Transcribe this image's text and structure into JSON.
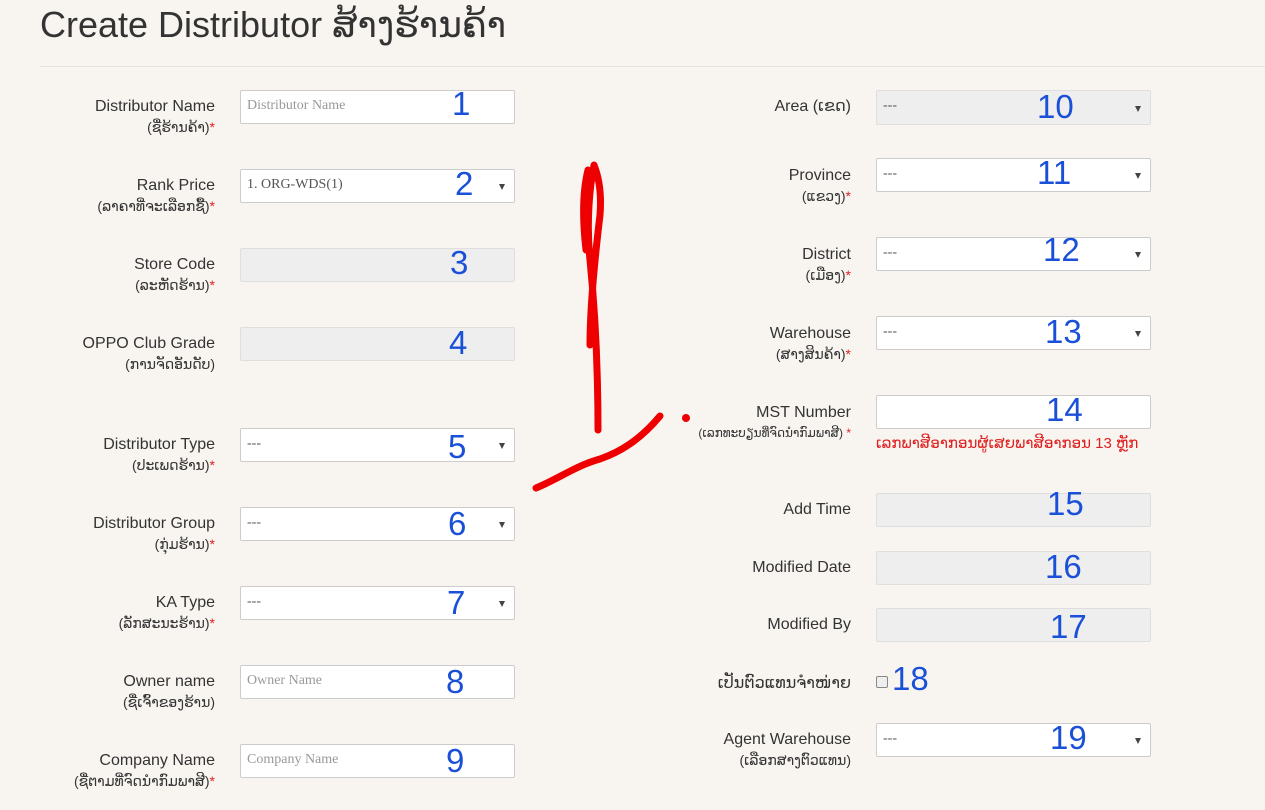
{
  "page": {
    "title": "Create Distributor ສ້າງຮ້ານຄ້າ"
  },
  "left_fields": [
    {
      "label": "Distributor Name",
      "sublabel": "(ຊື່ຮ້ານຄ້າ)",
      "required": "*",
      "placeholder": "Distributor Name",
      "value": "",
      "number": "1"
    },
    {
      "label": "Rank Price",
      "sublabel": "(ລາຄາທີ່ຈະເລືອກຊື້)",
      "required": "*",
      "value": "1. ORG-WDS(1)",
      "number": "2"
    },
    {
      "label": "Store Code",
      "sublabel": "(ລະຫັດຮ້ານ)",
      "required": "*",
      "value": "",
      "number": "3"
    },
    {
      "label": "OPPO Club Grade",
      "sublabel": "(ການຈັດອັນດັບ)",
      "required": "",
      "value": "",
      "number": "4"
    },
    {
      "label": "Distributor Type",
      "sublabel": "(ປະເພດຮ້ານ)",
      "required": "*",
      "value": "---",
      "number": "5"
    },
    {
      "label": "Distributor Group",
      "sublabel": "(ກຸ່ມຮ້ານ)",
      "required": "*",
      "value": "---",
      "number": "6"
    },
    {
      "label": "KA Type",
      "sublabel": "(ລັກສະນະຮ້ານ)",
      "required": "*",
      "value": "---",
      "number": "7"
    },
    {
      "label": "Owner name",
      "sublabel": "(ຊື່ເຈົ້າຂອງຮ້ານ)",
      "required": "",
      "placeholder": "Owner Name",
      "value": "",
      "number": "8"
    },
    {
      "label": "Company Name",
      "sublabel": "(ຊື່ຕາມທີ່ຈົດນຳກົມພາສີ)",
      "required": "*",
      "placeholder": "Company Name",
      "value": "",
      "number": "9"
    }
  ],
  "right_fields": [
    {
      "label": "Area (ເຂດ)",
      "sublabel": "",
      "required": "",
      "value": "---",
      "number": "10"
    },
    {
      "label": "Province",
      "sublabel": "(ແຂວງ)",
      "required": "*",
      "value": "---",
      "number": "11"
    },
    {
      "label": "District",
      "sublabel": "(ເມືອງ)",
      "required": "*",
      "value": "---",
      "number": "12"
    },
    {
      "label": "Warehouse",
      "sublabel": "(ສາງສິນຄ້າ)",
      "required": "*",
      "value": "---",
      "number": "13"
    },
    {
      "label": "MST Number",
      "sublabel": "(ເລກທະບຽນທີ່ຈົດນຳກົມພາສີ)",
      "required": "*",
      "value": "",
      "number": "14",
      "hint": "ເລກພາສີອາກອນຜູ້ເສຍພາສີອາກອນ 13 ຫຼັກ"
    },
    {
      "label": "Add Time",
      "sublabel": "",
      "required": "",
      "value": "",
      "number": "15"
    },
    {
      "label": "Modified Date",
      "sublabel": "",
      "required": "",
      "value": "",
      "number": "16"
    },
    {
      "label": "Modified By",
      "sublabel": "",
      "required": "",
      "value": "",
      "number": "17"
    },
    {
      "label": "ເປັນຕົວແທນຈຳໜ່າຍ",
      "sublabel": "",
      "required": "",
      "checked": false,
      "number": "18"
    },
    {
      "label": "Agent Warehouse",
      "sublabel": "(ເລືອກສາງຕົວແທນ)",
      "required": "",
      "value": "---",
      "number": "19"
    }
  ],
  "colors": {
    "background": "#f8f5f1",
    "required": "#e02020",
    "annotation_number": "#1a4fd8",
    "annotation_stroke": "#ee0000"
  }
}
